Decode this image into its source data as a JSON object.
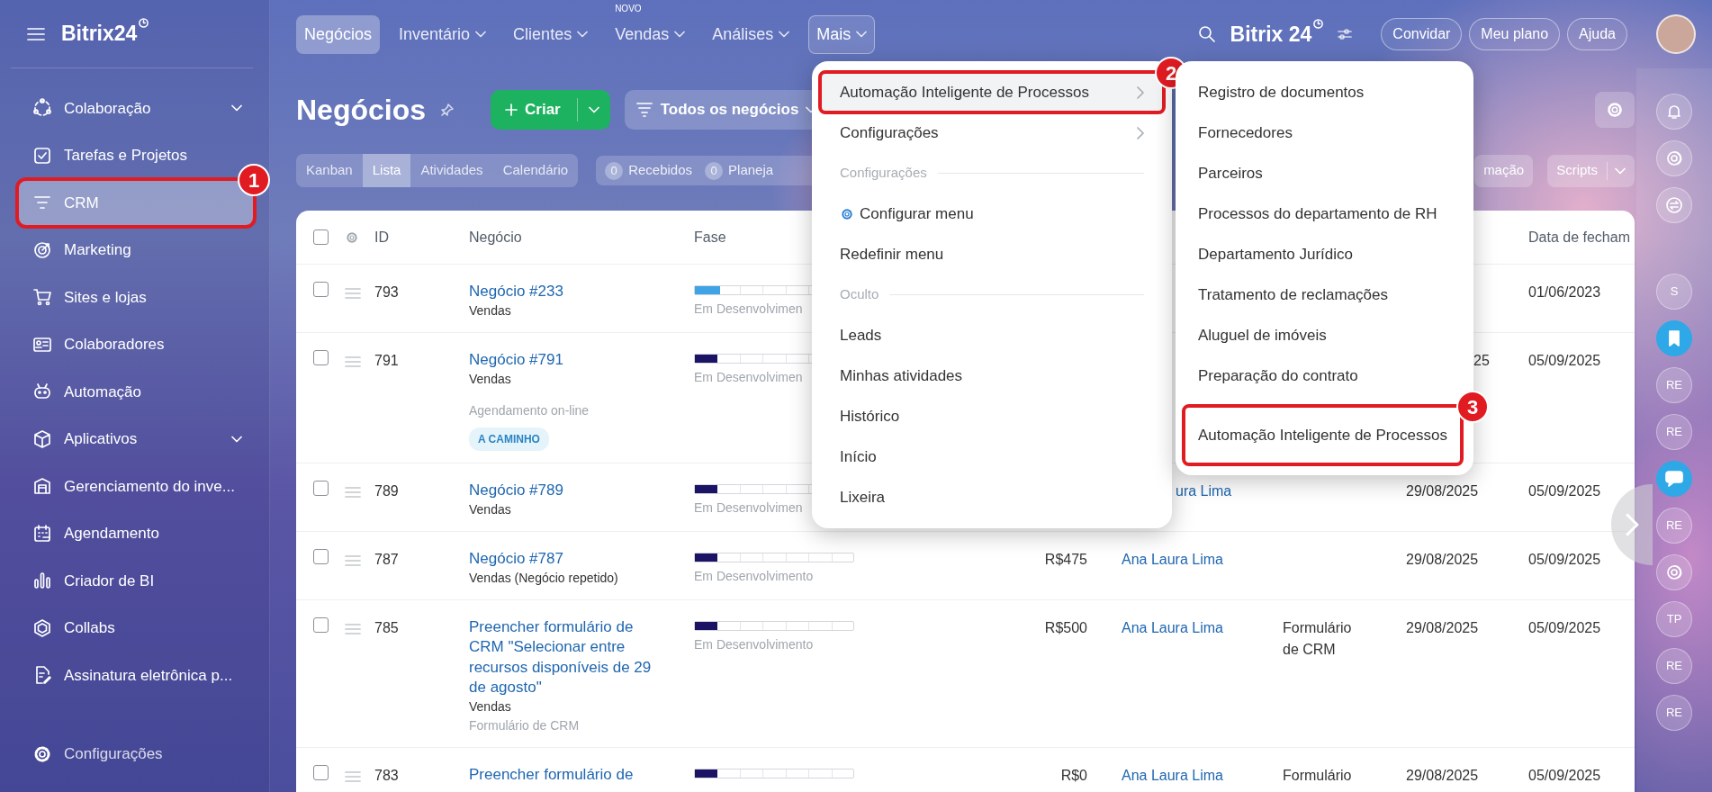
{
  "sidebar": {
    "logo": "Bitrix24",
    "items": [
      {
        "label": "Colaboração",
        "selected": false,
        "submenu": true
      },
      {
        "label": "Tarefas e Projetos",
        "selected": false,
        "submenu": false
      },
      {
        "label": "CRM",
        "selected": true,
        "submenu": false,
        "callout": "1"
      },
      {
        "label": "Marketing",
        "selected": false,
        "submenu": false
      },
      {
        "label": "Sites e lojas",
        "selected": false,
        "submenu": false
      },
      {
        "label": "Colaboradores",
        "selected": false,
        "submenu": false
      },
      {
        "label": "Automação",
        "selected": false,
        "submenu": false
      },
      {
        "label": "Aplicativos",
        "selected": false,
        "submenu": true
      },
      {
        "label": "Gerenciamento do inve...",
        "selected": false,
        "submenu": false
      },
      {
        "label": "Agendamento",
        "selected": false,
        "submenu": false
      },
      {
        "label": "Criador de BI",
        "selected": false,
        "submenu": false
      },
      {
        "label": "Collabs",
        "selected": false,
        "submenu": false
      },
      {
        "label": "Assinatura eletrônica p...",
        "selected": false,
        "submenu": false
      }
    ],
    "footer_item": {
      "label": "Configurações"
    }
  },
  "topbar": {
    "tabs": [
      {
        "label": "Negócios",
        "selected": true,
        "dropdown": false,
        "open": false
      },
      {
        "label": "Inventário",
        "selected": false,
        "dropdown": true,
        "open": false
      },
      {
        "label": "Clientes",
        "selected": false,
        "dropdown": true,
        "open": false
      },
      {
        "label": "Vendas",
        "selected": false,
        "dropdown": true,
        "open": false,
        "tag": "NOVO"
      },
      {
        "label": "Análises",
        "selected": false,
        "dropdown": true,
        "open": false
      },
      {
        "label": "Mais",
        "selected": false,
        "dropdown": true,
        "open": true
      }
    ],
    "logo": "Bitrix 24",
    "actions": [
      "Convidar",
      "Meu plano",
      "Ajuda"
    ]
  },
  "page": {
    "title": "Negócios",
    "create_button": "Criar",
    "filter_button": "Todos os negócios",
    "view_tabs": [
      {
        "label": "Kanban",
        "selected": false
      },
      {
        "label": "Lista",
        "selected": true
      },
      {
        "label": "Atividades",
        "selected": false
      },
      {
        "label": "Calendário",
        "selected": false
      }
    ],
    "counters": [
      {
        "count": "0",
        "label": "Recebidos"
      },
      {
        "count": "0",
        "label": "Planeja"
      }
    ],
    "toolbar_buttons": [
      {
        "label": "mação",
        "split": false
      },
      {
        "label": "Scripts",
        "split": true
      }
    ]
  },
  "table": {
    "all_checked": false,
    "columns": [
      "ID",
      "Negócio",
      "Fase",
      "Data de fecham"
    ],
    "rows": [
      {
        "id": "793",
        "checked": false,
        "title": "Negócio #233",
        "pipeline": "Vendas",
        "stage": {
          "label": "Em Desenvolvimen",
          "level": 0.16,
          "color": "#3fa3e6"
        },
        "close_date": "01/06/2023"
      },
      {
        "id": "791",
        "checked": false,
        "title": "Negócio #791",
        "pipeline": "Vendas",
        "note": "Agendamento on-line",
        "tag": "A CAMINHO",
        "stage": {
          "label": "Em Desenvolvimen",
          "level": 0.14,
          "color": "#1b1464"
        },
        "created_partial": "25",
        "close_date": "05/09/2025"
      },
      {
        "id": "789",
        "checked": false,
        "title": "Negócio #789",
        "pipeline": "Vendas",
        "stage": {
          "label": "Em Desenvolvimen",
          "level": 0.14,
          "color": "#1b1464"
        },
        "responsible_partial": "ura Lima",
        "created": "29/08/2025",
        "close_date": "05/09/2025"
      },
      {
        "id": "787",
        "checked": false,
        "title": "Negócio #787",
        "pipeline": "Vendas (Negócio repetido)",
        "stage": {
          "label": "Em Desenvolvimento",
          "level": 0.14,
          "color": "#1b1464"
        },
        "amount": "R$475",
        "responsible": "Ana Laura Lima",
        "created": "29/08/2025",
        "close_date": "05/09/2025"
      },
      {
        "id": "785",
        "checked": false,
        "title": "Preencher formulário de CRM \"Selecionar entre recursos disponíveis de 29 de agosto\"",
        "pipeline": "Vendas",
        "note": "Formulário de CRM",
        "stage": {
          "label": "Em Desenvolvimento",
          "level": 0.14,
          "color": "#1b1464"
        },
        "amount": "R$500",
        "responsible": "Ana Laura Lima",
        "source": "Formulário de CRM",
        "created": "29/08/2025",
        "close_date": "05/09/2025"
      },
      {
        "id": "783",
        "checked": false,
        "title": "Preencher formulário de",
        "stage": {
          "level": 0.14,
          "color": "#1b1464"
        },
        "amount": "R$0",
        "responsible": "Ana Laura Lima",
        "source": "Formulário",
        "created": "29/08/2025",
        "close_date": "05/09/2025"
      }
    ]
  },
  "menu": {
    "items": [
      {
        "kind": "item",
        "label": "Automação Inteligente de Processos",
        "selected": true,
        "submenu": true,
        "callout": "2"
      },
      {
        "kind": "item",
        "label": "Configurações",
        "selected": false,
        "submenu": true
      },
      {
        "kind": "section",
        "label": "Configurações"
      },
      {
        "kind": "setting",
        "label": "Configurar menu",
        "selected": false,
        "submenu": false
      },
      {
        "kind": "item",
        "label": "Redefinir menu",
        "selected": false,
        "submenu": false
      },
      {
        "kind": "section",
        "label": "Oculto"
      },
      {
        "kind": "item",
        "label": "Leads",
        "selected": false,
        "submenu": false
      },
      {
        "kind": "item",
        "label": "Minhas atividades",
        "selected": false,
        "submenu": false
      },
      {
        "kind": "item",
        "label": "Histórico",
        "selected": false,
        "submenu": false
      },
      {
        "kind": "item",
        "label": "Início",
        "selected": false,
        "submenu": false
      },
      {
        "kind": "item",
        "label": "Lixeira",
        "selected": false,
        "submenu": false
      }
    ]
  },
  "submenu": {
    "items": [
      {
        "label": "Registro de documentos"
      },
      {
        "label": "Fornecedores"
      },
      {
        "label": "Parceiros"
      },
      {
        "label": "Processos do departamento de RH"
      },
      {
        "label": "Departamento Jurídico"
      },
      {
        "label": "Tratamento de reclamações"
      },
      {
        "label": "Aluguel de imóveis"
      },
      {
        "label": "Preparação do contrato"
      },
      {
        "label": "Automação Inteligente de Processos",
        "callout": "3"
      }
    ]
  },
  "rail": {
    "items": [
      {
        "kind": "bell"
      },
      {
        "kind": "sync"
      },
      {
        "kind": "exchange"
      },
      {
        "kind": "avatar",
        "label": "S"
      },
      {
        "kind": "bookmark"
      },
      {
        "kind": "avatar",
        "label": "RE"
      },
      {
        "kind": "avatar",
        "label": "RE"
      },
      {
        "kind": "chat"
      },
      {
        "kind": "avatar",
        "label": "RE"
      },
      {
        "kind": "sync"
      },
      {
        "kind": "avatar",
        "label": "TP"
      },
      {
        "kind": "avatar",
        "label": "RE"
      },
      {
        "kind": "avatar",
        "label": "RE"
      }
    ]
  }
}
